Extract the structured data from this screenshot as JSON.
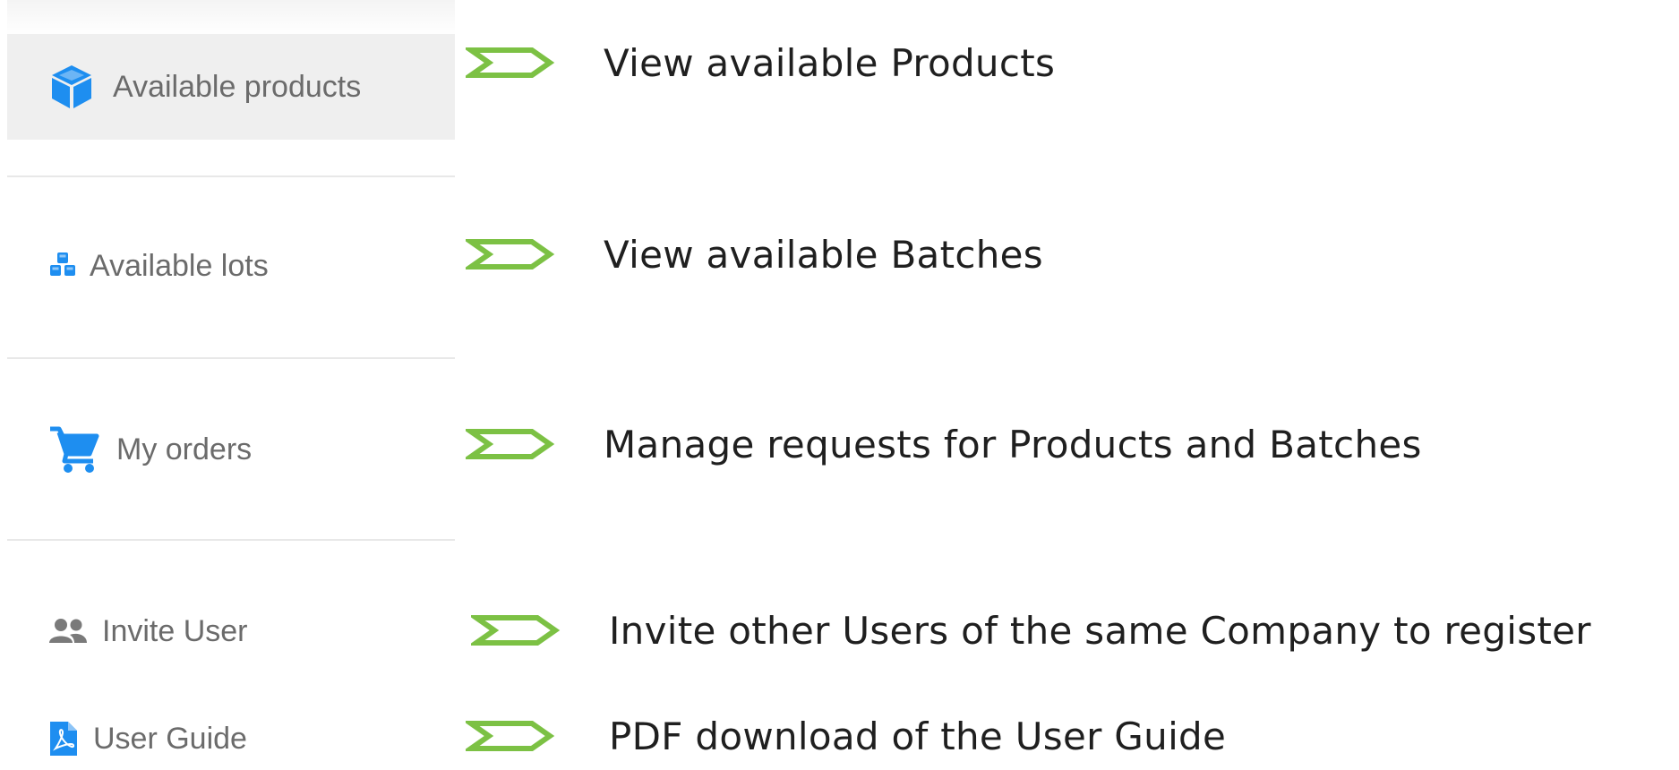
{
  "sidebar": {
    "items": [
      {
        "label": "Available products",
        "icon": "cube-icon"
      },
      {
        "label": "Available lots",
        "icon": "cubes-icon"
      },
      {
        "label": "My orders",
        "icon": "cart-icon"
      },
      {
        "label": "Invite User",
        "icon": "users-icon"
      },
      {
        "label": "User Guide",
        "icon": "pdf-file-icon"
      }
    ]
  },
  "descriptions": [
    "View available Products",
    "View available Batches",
    "Manage requests for Products and Batches",
    "Invite other Users of the same Company to register",
    "PDF download of the User Guide"
  ],
  "colors": {
    "accent_blue": "#1e8ef0",
    "arrow_green": "#7cc144",
    "label_gray": "#6b6b6b",
    "active_bg": "#efefef",
    "divider": "#e8e8e8",
    "gray_icon": "#7a7a7a"
  }
}
